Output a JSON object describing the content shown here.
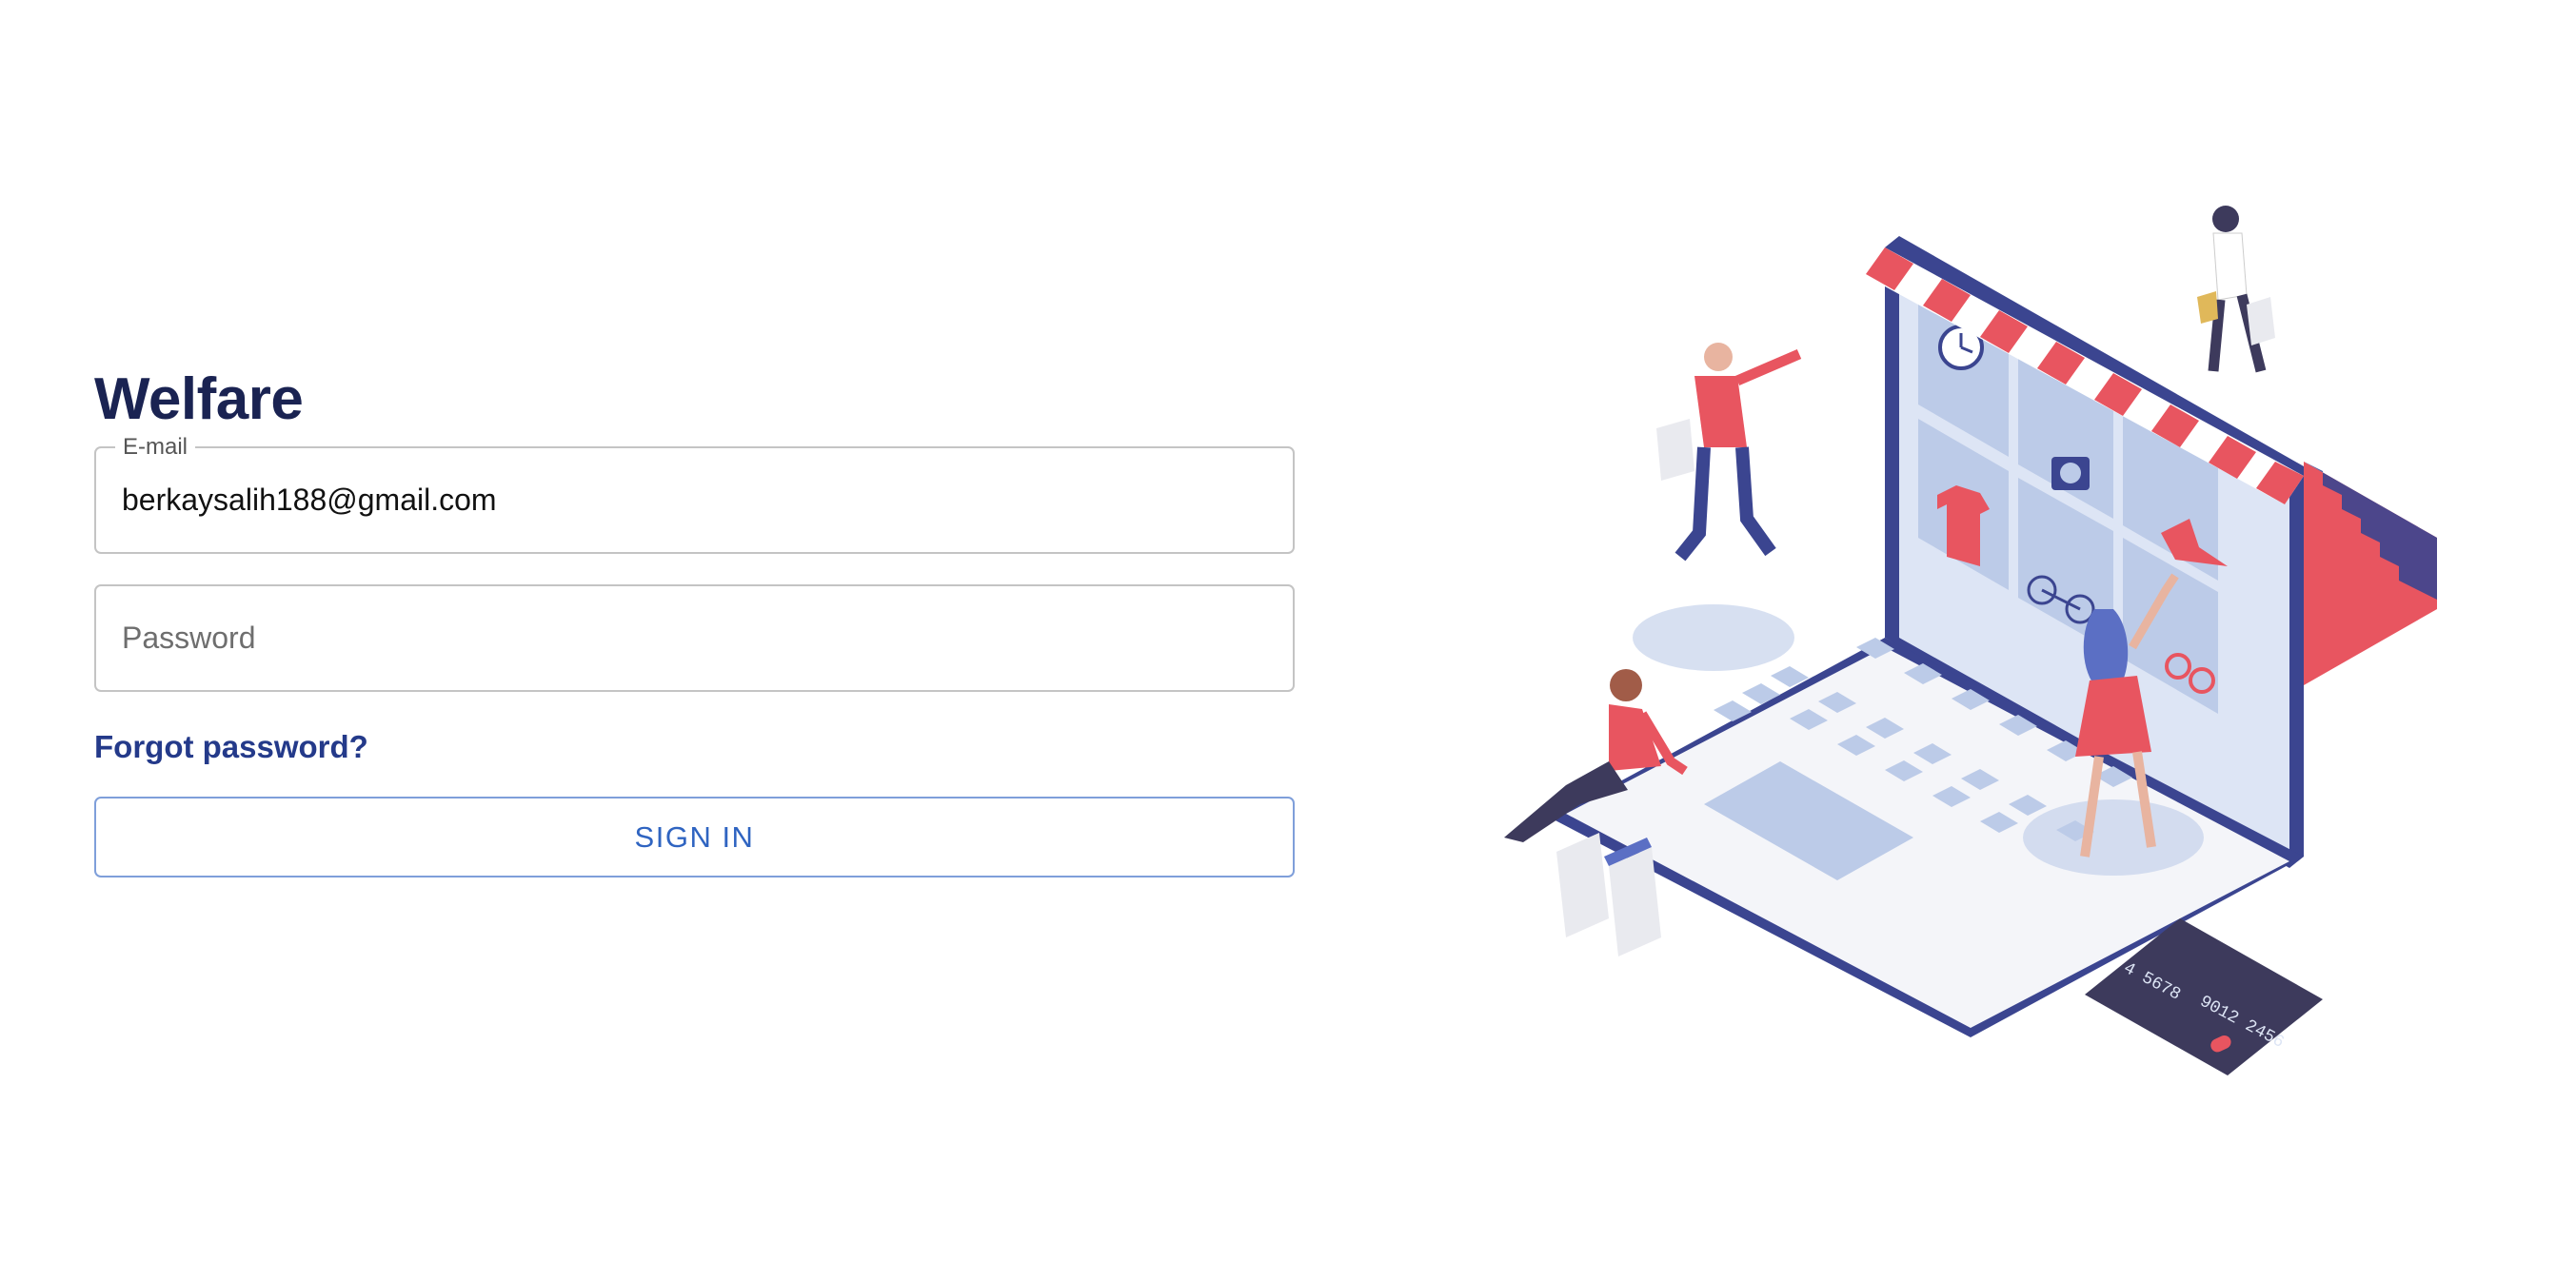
{
  "app": {
    "title": "Welfare"
  },
  "login": {
    "email_label": "E-mail",
    "email_value": "berkaysalih188@gmail.com",
    "password_placeholder": "Password",
    "forgot_label": "Forgot password?",
    "signin_label": "SIGN IN"
  },
  "illustration": {
    "card_number_left": "4 5678",
    "card_number_right": "9012 2456"
  },
  "colors": {
    "title": "#1a2352",
    "link": "#243a8a",
    "button_text": "#2f64c1",
    "accent_red": "#e85560",
    "accent_navy": "#3b4590",
    "accent_light_blue": "#bccbe8"
  }
}
